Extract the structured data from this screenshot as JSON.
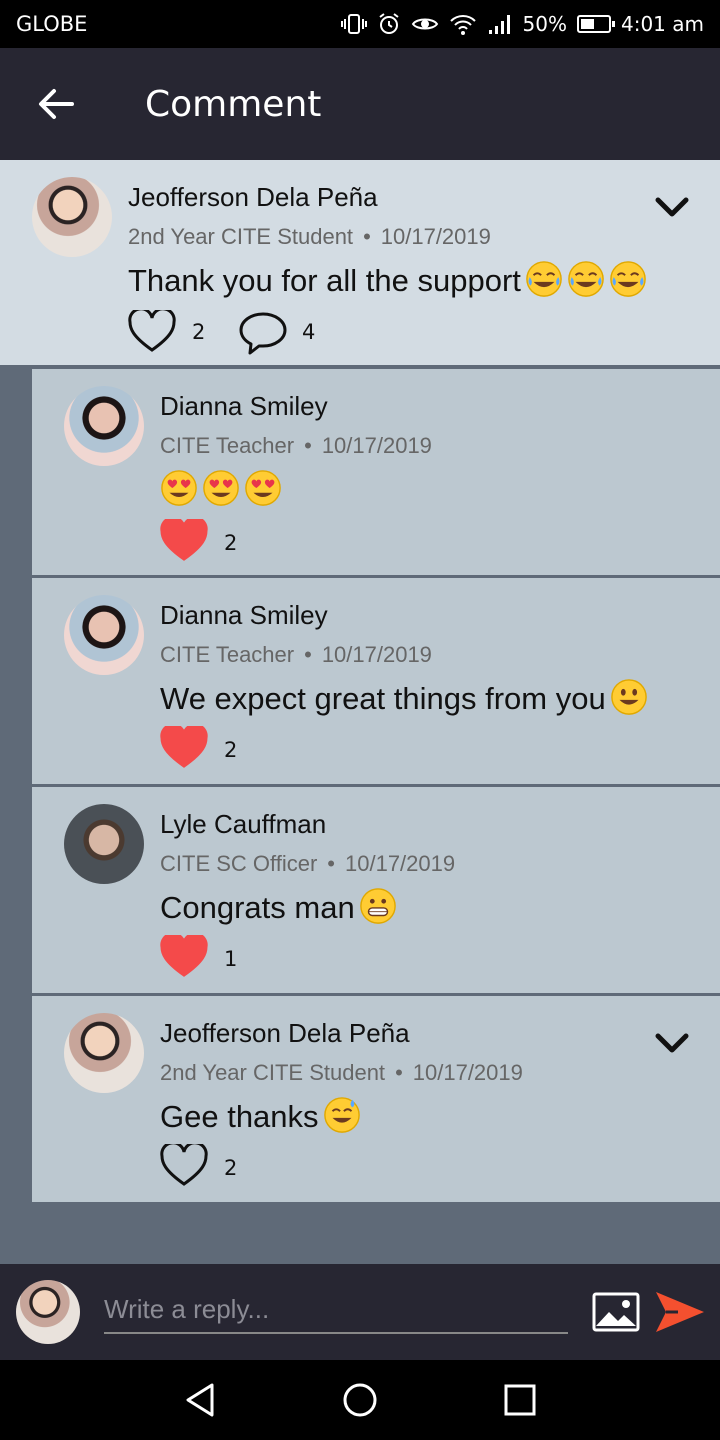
{
  "status": {
    "carrier": "GLOBE",
    "battery": "50%",
    "time": "4:01 am",
    "battery_level": 0.5
  },
  "header": {
    "title": "Comment"
  },
  "post": {
    "author": "Jeofferson Dela Peña",
    "role": "2nd Year CITE Student",
    "date": "10/17/2019",
    "text": "Thank you for all the support",
    "emojis": [
      "joy-emoji",
      "joy-emoji",
      "rofl-emoji"
    ],
    "likes": "2",
    "comments": "4",
    "liked": false
  },
  "replies": [
    {
      "author": "Dianna Smiley",
      "role": "CITE Teacher",
      "date": "10/17/2019",
      "text": "",
      "emojis": [
        "heart-eyes-emoji",
        "heart-eyes-emoji",
        "heart-eyes-emoji"
      ],
      "likes": "2",
      "liked": true
    },
    {
      "author": "Dianna Smiley",
      "role": "CITE Teacher",
      "date": "10/17/2019",
      "text": "We expect great things from you",
      "emojis": [
        "smiley-emoji"
      ],
      "likes": "2",
      "liked": true
    },
    {
      "author": "Lyle Cauffman",
      "role": "CITE SC Officer",
      "date": "10/17/2019",
      "text": "Congrats man",
      "emojis": [
        "grin-emoji"
      ],
      "likes": "1",
      "liked": true
    },
    {
      "author": "Jeofferson Dela Peña",
      "role": "2nd Year CITE Student",
      "date": "10/17/2019",
      "text": "Gee thanks",
      "emojis": [
        "sweat-smile-emoji"
      ],
      "likes": "2",
      "liked": false
    }
  ],
  "composer": {
    "placeholder": "Write a reply..."
  },
  "colors": {
    "heart": "#f44a4a",
    "send": "#f4502f",
    "appbar": "#272632",
    "post_bg": "#d3dce3",
    "reply_bg": "#bcc8d0"
  }
}
